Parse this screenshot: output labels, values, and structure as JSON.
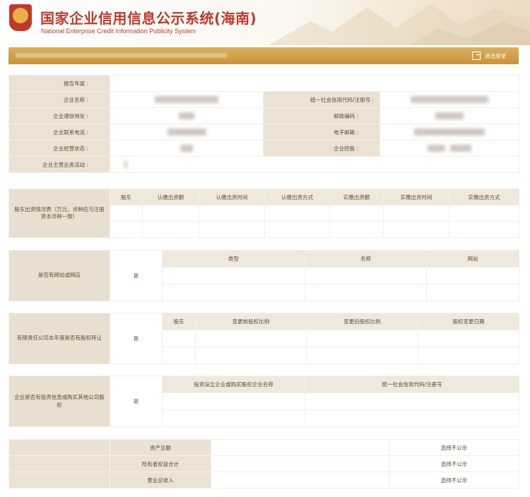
{
  "header": {
    "title_cn": "国家企业信用信息公示系统(海南)",
    "title_en": "National Enterprise Credit Information Publicity System"
  },
  "topbar": {
    "logout_label": "退出登录"
  },
  "basic_info": {
    "report_year_label": "报告年度 :",
    "company_name_label": "企业名称 :",
    "credit_code_label": "统一社会信用代码/注册号 :",
    "address_label": "企业通信地址 :",
    "postcode_label": "邮政编码 :",
    "phone_label": "企业联系电话 :",
    "email_label": "电子邮箱 :",
    "status_label": "企业经营状态 :",
    "holding_label": "企业控股 :",
    "main_business_label": "企业主营业务活动 :"
  },
  "investment": {
    "row_label": "股东出资情况表（万元，币种应与注册资本币种一致）",
    "columns": [
      "股东",
      "认缴出资额",
      "认缴出资时间",
      "认缴出资方式",
      "实缴出资额",
      "实缴出资时间",
      "实缴出资方式"
    ]
  },
  "website": {
    "row_label": "是否有网站或网店",
    "answer": "是",
    "columns": [
      "类型",
      "名称",
      "网站"
    ]
  },
  "equity_transfer": {
    "row_label": "有限责任公司本年度是否有股权转让",
    "answer": "是",
    "columns": [
      "股东",
      "变更前股权比例",
      "变更后股权比例",
      "股权变更日期"
    ]
  },
  "equity_investment": {
    "row_label": "企业是否有投资信息或购买其他公司股权",
    "answer": "是",
    "columns": [
      "投资设立企业或购买股权企业名称",
      "统一社会信用代码/注册号"
    ]
  },
  "assets": {
    "rows": [
      {
        "label": "资产总额",
        "status": "选择不公示"
      },
      {
        "label": "所有者权益合计",
        "status": "选择不公示"
      },
      {
        "label": "营业总收入",
        "status": "选择不公示"
      }
    ]
  },
  "colors": {
    "accent": "#c9933a",
    "brand_red": "#c0392b",
    "label_bg": "#ebe2d4"
  }
}
